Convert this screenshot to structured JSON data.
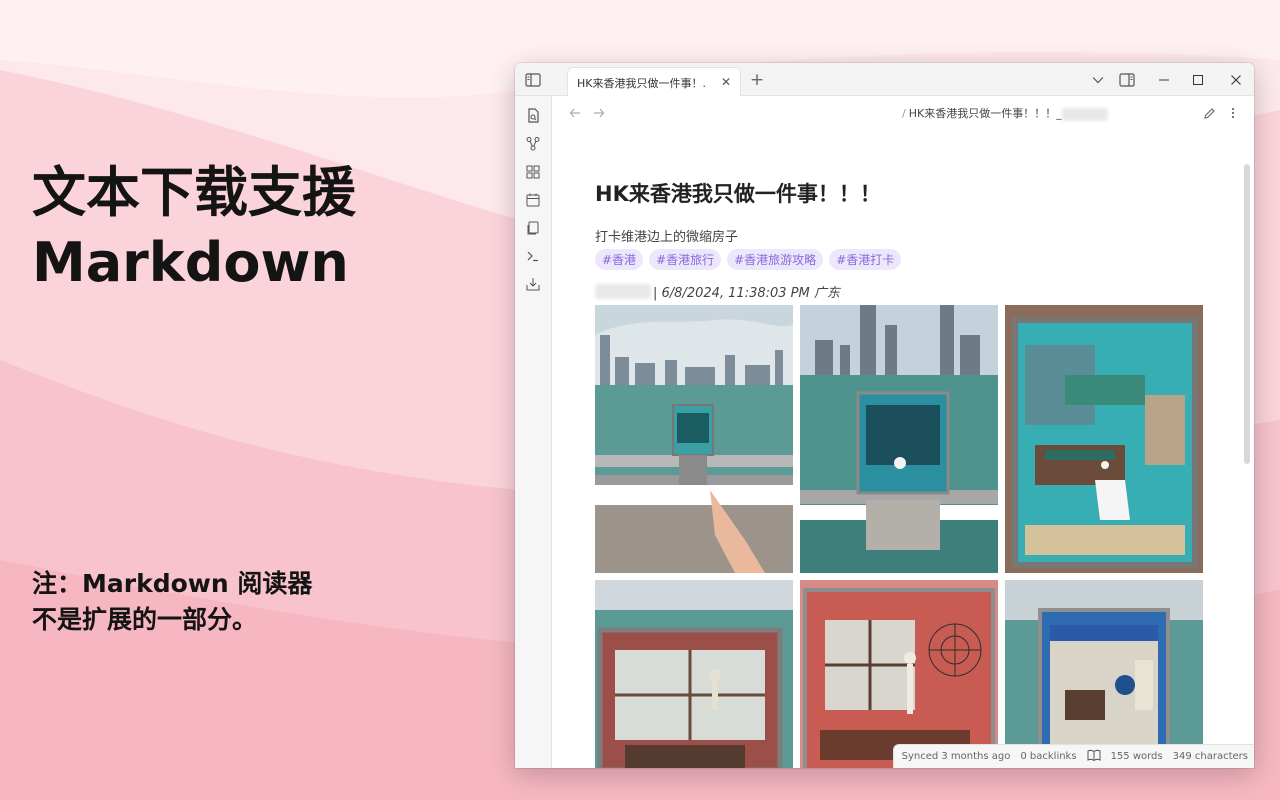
{
  "promo": {
    "title_line1": "文本下载支援",
    "title_line2": "Markdown",
    "note_line1": "注：Markdown 阅读器",
    "note_line2": "不是扩展的一部分。"
  },
  "window": {
    "tab_label": "HK来香港我只做一件事！...",
    "tab_close": "✕",
    "new_tab": "+"
  },
  "breadcrumb": {
    "separator": "/",
    "current": "HK来香港我只做一件事！！！_"
  },
  "document": {
    "title": "HK来香港我只做一件事！！！",
    "subtitle": "打卡维港边上的微缩房子",
    "tags": [
      "#香港",
      "#香港旅行",
      "#香港旅游攻略",
      "#香港打卡"
    ],
    "meta": "| 6/8/2024, 11:38:03 PM 广东"
  },
  "status": {
    "synced": "Synced 3 months ago",
    "backlinks": "0 backlinks",
    "words": "155 words",
    "characters": "349 characters"
  },
  "photos": [
    {
      "name": "photo-harbor-pointing",
      "sky": "#c9d6dd",
      "sea": "#5c9a96",
      "box": "#3aa0a4"
    },
    {
      "name": "photo-harbor-box",
      "sky": "#c6d2db",
      "sea": "#4f938f",
      "box": "#2c8fa0"
    },
    {
      "name": "photo-room-closeup",
      "sky": "#6fc7c9",
      "sea": "#8b6b5a",
      "box": "#37aeb4"
    },
    {
      "name": "photo-halloween-window",
      "sky": "#cfd7dc",
      "sea": "#5c9a96",
      "box": "#c1564a"
    },
    {
      "name": "photo-skeleton-room",
      "sky": "#d88a86",
      "sea": "#c9534b",
      "box": "#c95c52"
    },
    {
      "name": "photo-blue-curtain",
      "sky": "#c8d2d6",
      "sea": "#5b9a96",
      "box": "#2f6bb1"
    }
  ],
  "colors": {
    "accent": "#8a67e0",
    "tag_bg": "#ece7fb",
    "background": "#fce3e7"
  }
}
